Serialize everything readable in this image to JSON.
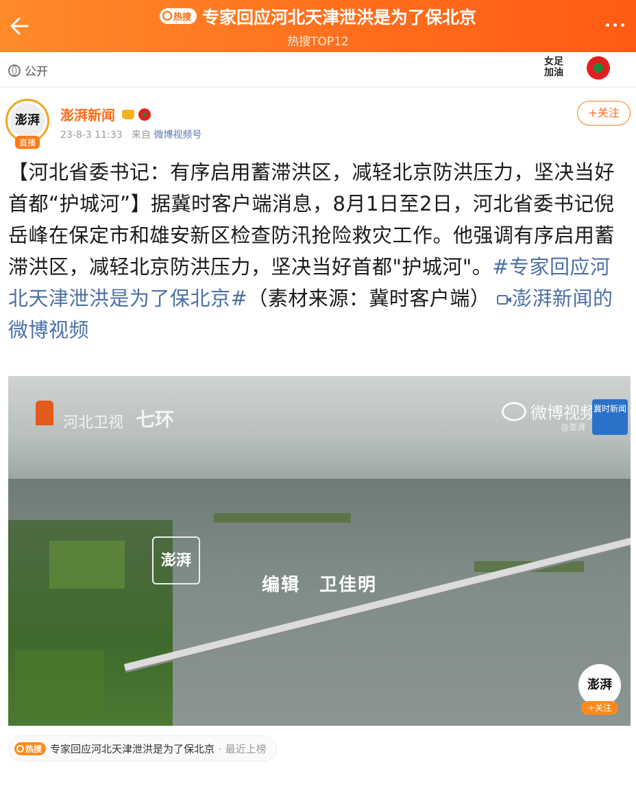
{
  "header": {
    "back_icon": "arrow-left-icon",
    "hot_badge": "热搜",
    "title": "专家回应河北天津泄洪是为了保北京",
    "subtitle": "热搜TOP12",
    "more_icon": "more-dots-icon"
  },
  "privacy": {
    "label": "公开",
    "icon": "globe-icon"
  },
  "sticker": {
    "text_line1": "女足",
    "text_line2": "加油"
  },
  "author": {
    "avatar_text": "澎湃",
    "live_tag": "直播",
    "name": "澎湃新闻",
    "time": "23-8-3 11:33",
    "from_label": "来自",
    "source": "微博视频号",
    "follow_label": "+关注"
  },
  "post": {
    "text_main": "【河北省委书记：有序启用蓄滞洪区，减轻北京防洪压力，坚决当好首都“护城河”】据冀时客户端消息，8月1日至2日，河北省委书记倪岳峰在保定市和雄安新区检查防汛抢险救灾工作。他强调有序启用蓄滞洪区，减轻北京防洪压力，坚决当好首都\"护城河\"。",
    "hashtag": "#专家回应河北天津泄洪是为了保北京#",
    "source_note": "（素材来源：冀时客户端）",
    "video_link": "澎湃新闻的微博视频"
  },
  "video": {
    "channel_logo": "河北卫视",
    "program_logo": "七环",
    "watermark": "微博视频号",
    "watermark_handle": "@澎湃",
    "corner_badge": "冀时新闻",
    "center_logo": "澎湃",
    "editor_label": "编辑",
    "editor_name": "卫佳明",
    "float_logo": "澎湃",
    "float_follow": "+关注"
  },
  "footer_chip": {
    "badge": "热搜",
    "text": "专家回应河北天津泄洪是为了保北京",
    "suffix": "· 最近上榜"
  },
  "colors": {
    "accent": "#ff6a1a",
    "link": "#4b6fa8"
  }
}
